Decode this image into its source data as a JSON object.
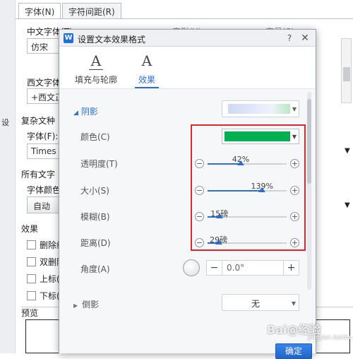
{
  "background_dialog": {
    "tabs": [
      "字体(N)",
      "字符间距(R)"
    ],
    "left_strip_text": "设",
    "labels": {
      "chinese_font": "中文字体(T)",
      "style": "字形(Y)",
      "size": "字号(S)",
      "western_font": "西文字体",
      "complex_script": "复杂文种",
      "complex_font": "字体(F):",
      "all_text": "所有文字",
      "font_color": "字体颜色",
      "effects": "效果",
      "preview": "预览"
    },
    "fields": {
      "chinese_font_value": "仿宋",
      "western_font_value": "+西文正",
      "complex_font_value": "Times",
      "auto_button": "自动"
    },
    "checkboxes": [
      "删除线",
      "双删除",
      "上标(",
      "下标("
    ]
  },
  "dialog": {
    "title": "设置文本效果格式",
    "help": "?",
    "close": "✕",
    "tabs": [
      {
        "glyph": "A",
        "label": "填充与轮廓"
      },
      {
        "glyph": "A",
        "label": "效果"
      }
    ],
    "shadow": {
      "label": "阴影",
      "color_label": "颜色(C)",
      "color_value": "#00b050",
      "properties": [
        {
          "label": "透明度(T)",
          "value_text": "42%",
          "fraction": 0.42
        },
        {
          "label": "大小(S)",
          "value_text": "139%",
          "fraction": 0.69
        },
        {
          "label": "模糊(B)",
          "value_text": "15磅",
          "fraction": 0.15
        },
        {
          "label": "距离(D)",
          "value_text": "29磅",
          "fraction": 0.14
        }
      ],
      "angle_label": "角度(A)",
      "angle_value": "0.0°",
      "minus": "−",
      "plus": "+"
    },
    "reflection": {
      "label": "倒影",
      "value": "无"
    },
    "ok_button": "确定"
  },
  "watermark": {
    "text": "Bai@经验",
    "sub": "jingyan.baidu.com"
  },
  "colors": {
    "accent": "#2c6fd1",
    "annotation": "#e0262a",
    "shadow_color": "#00b050"
  }
}
